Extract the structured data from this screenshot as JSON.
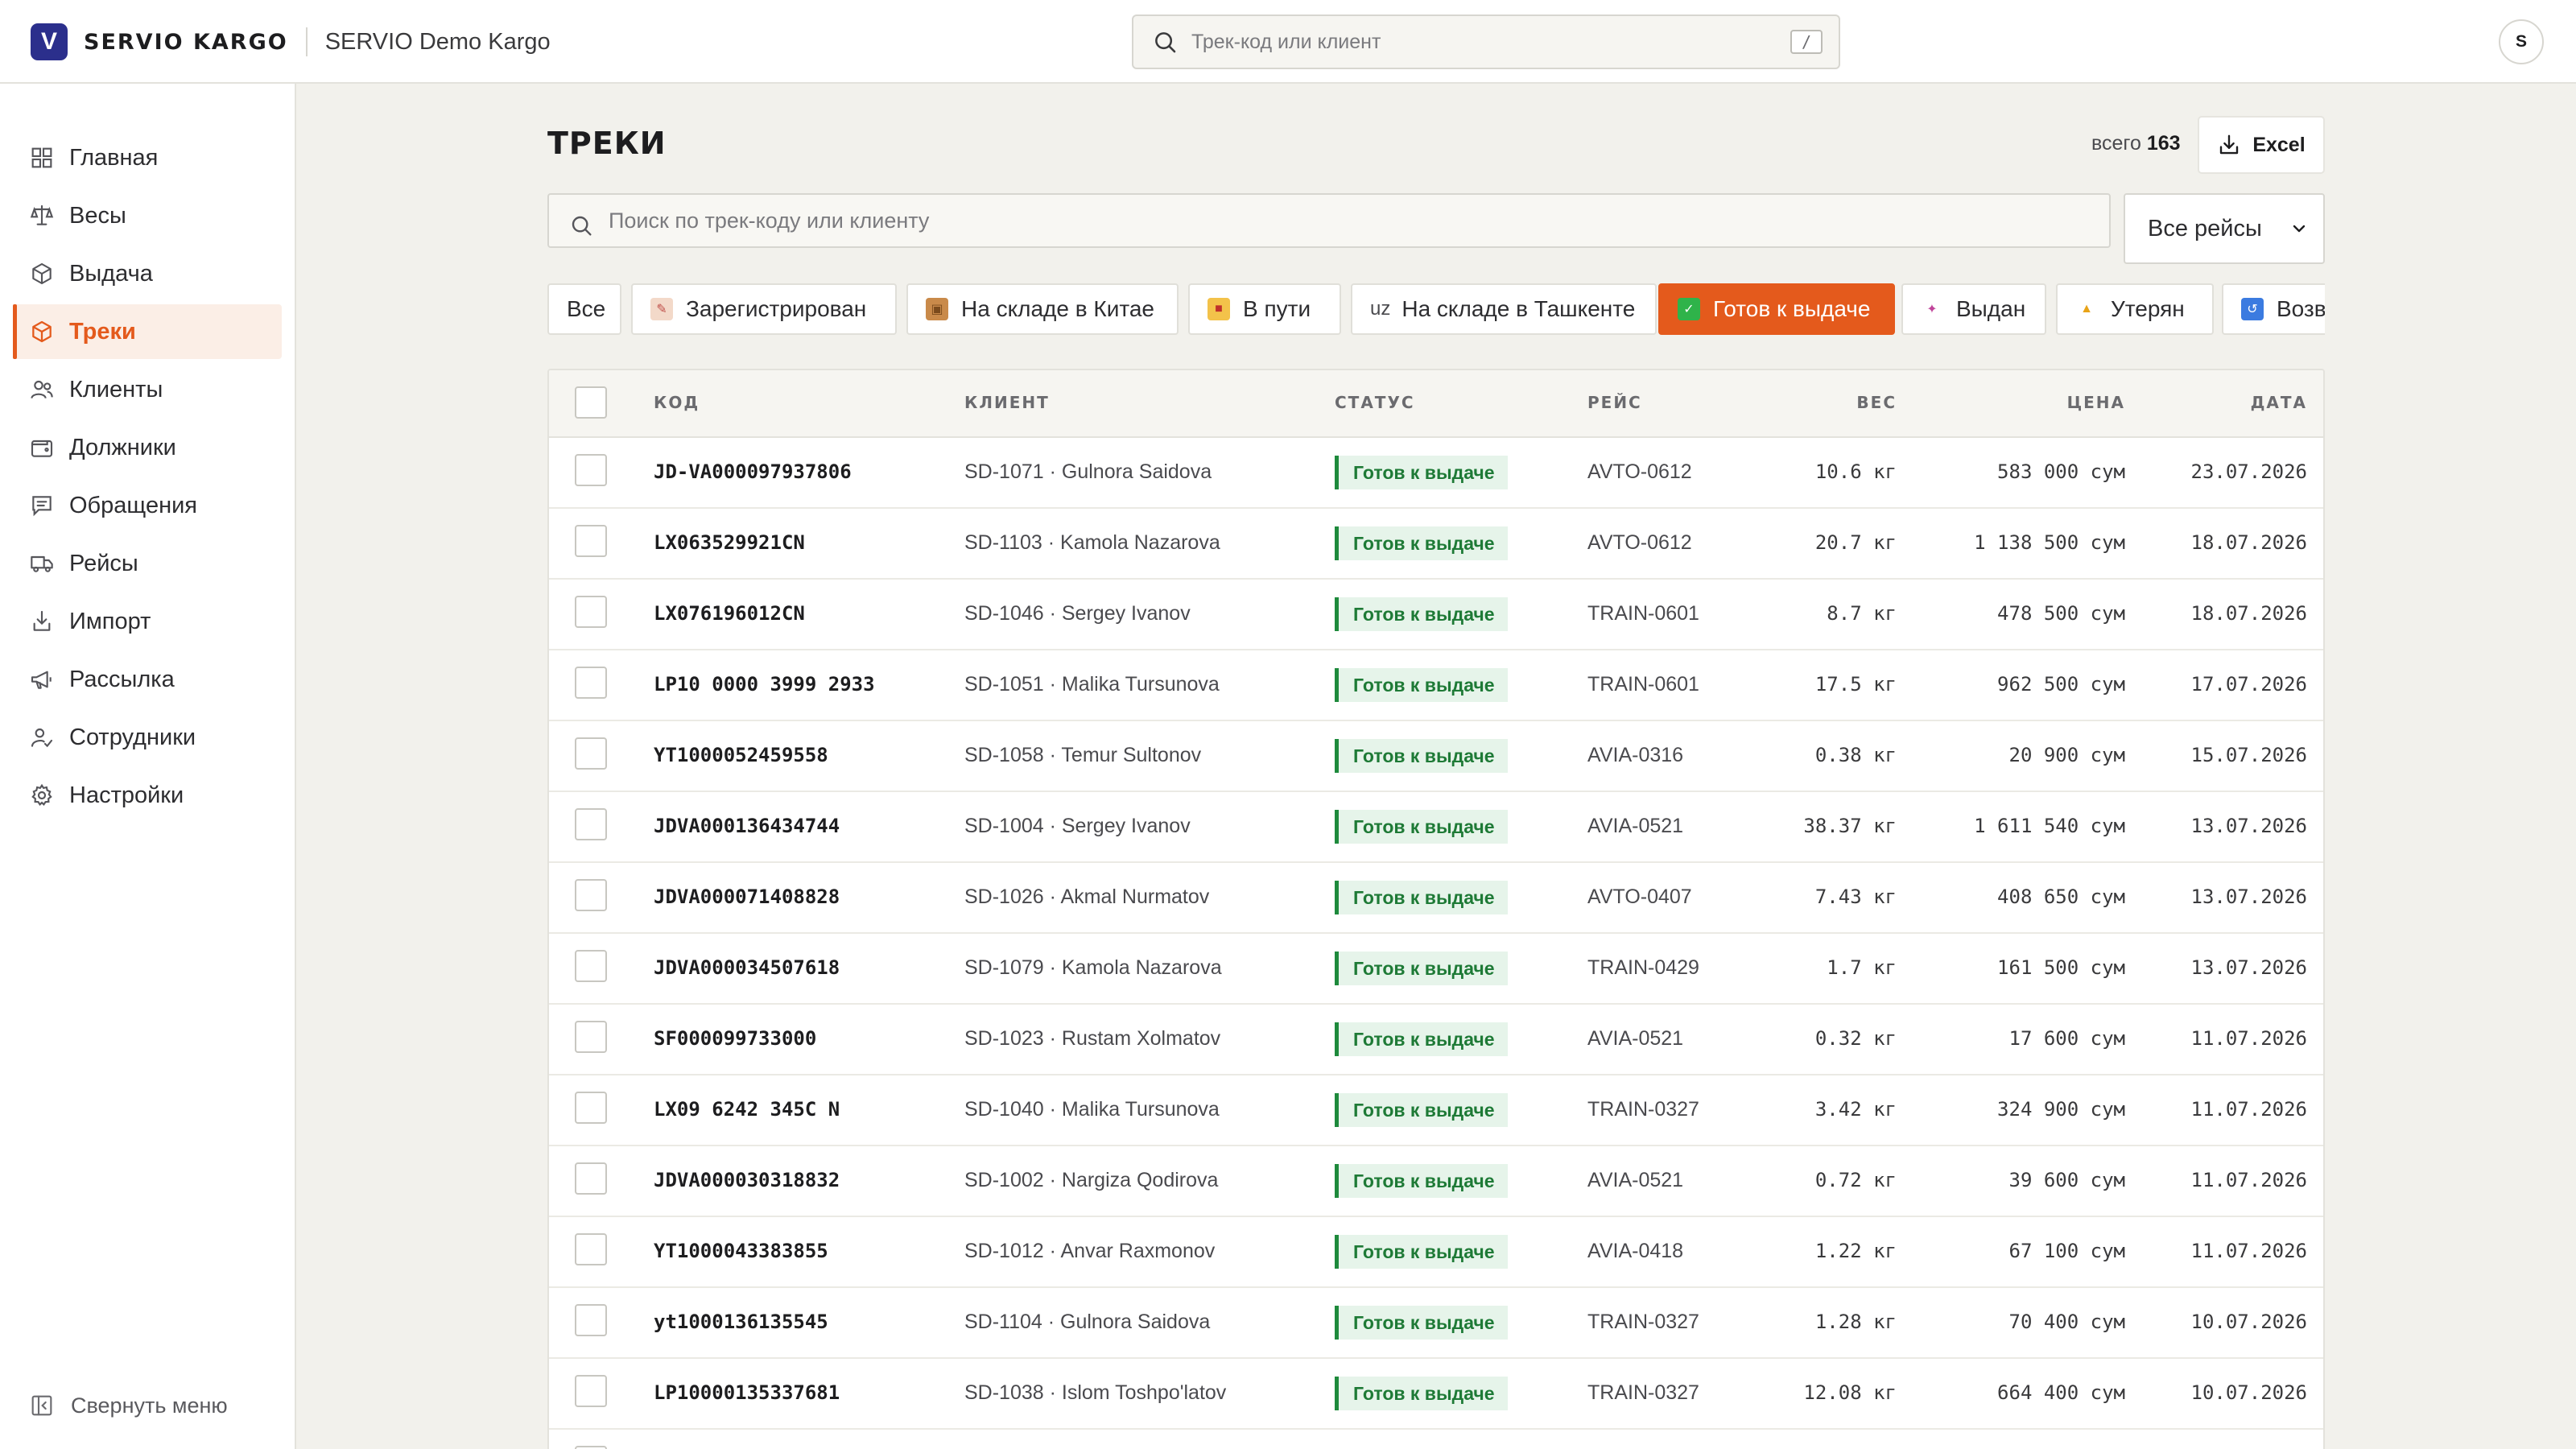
{
  "brand": {
    "logo_letter": "V",
    "name": "SERVIO KARGO",
    "org": "SERVIO Demo Kargo"
  },
  "top_search": {
    "placeholder": "Трек-код или клиент",
    "shortcut": "/"
  },
  "user": {
    "initial": "S"
  },
  "sidebar": {
    "items": [
      {
        "label": "Главная",
        "icon": "grid-icon"
      },
      {
        "label": "Весы",
        "icon": "scale-icon"
      },
      {
        "label": "Выдача",
        "icon": "package-icon"
      },
      {
        "label": "Треки",
        "icon": "box-icon",
        "active": true
      },
      {
        "label": "Клиенты",
        "icon": "users-icon"
      },
      {
        "label": "Должники",
        "icon": "wallet-icon"
      },
      {
        "label": "Обращения",
        "icon": "message-icon"
      },
      {
        "label": "Рейсы",
        "icon": "truck-icon"
      },
      {
        "label": "Импорт",
        "icon": "import-icon"
      },
      {
        "label": "Рассылка",
        "icon": "megaphone-icon"
      },
      {
        "label": "Сотрудники",
        "icon": "staff-icon"
      },
      {
        "label": "Настройки",
        "icon": "gear-icon"
      }
    ],
    "collapse_label": "Свернуть меню"
  },
  "page": {
    "title": "ТРЕКИ",
    "total_prefix": "всего",
    "total_count": "163",
    "excel_label": "Excel",
    "search_placeholder": "Поиск по трек-коду или клиенту",
    "flight_filter": "Все рейсы"
  },
  "chips": [
    {
      "label": "Все",
      "icon": ""
    },
    {
      "label": "Зарегистрирован",
      "icon": "memo-icon"
    },
    {
      "label": "На складе в Китае",
      "icon": "package-icon"
    },
    {
      "label": "В пути",
      "icon": "truck-icon"
    },
    {
      "label": "На складе в Ташкенте",
      "icon": "uz-flag-icon",
      "prefix": "uz"
    },
    {
      "label": "Готов к выдаче",
      "icon": "check-icon",
      "active": true
    },
    {
      "label": "Выдан",
      "icon": "party-icon"
    },
    {
      "label": "Утерян",
      "icon": "warning-icon"
    },
    {
      "label": "Возвр",
      "icon": "return-icon"
    }
  ],
  "table": {
    "columns": {
      "code": "КОД",
      "client": "КЛИЕНТ",
      "status": "СТАТУС",
      "flight": "РЕЙС",
      "weight": "ВЕС",
      "price": "ЦЕНА",
      "date": "ДАТА"
    },
    "rows": [
      {
        "code": "JD-VA000097937806",
        "client": "SD-1071 · Gulnora Saidova",
        "status": "Готов к выдаче",
        "flight": "AVTO-0612",
        "weight": "10.6 кг",
        "price": "583 000 сум",
        "date": "23.07.2026"
      },
      {
        "code": "LX063529921CN",
        "client": "SD-1103 · Kamola Nazarova",
        "status": "Готов к выдаче",
        "flight": "AVTO-0612",
        "weight": "20.7 кг",
        "price": "1 138 500 сум",
        "date": "18.07.2026"
      },
      {
        "code": "LX076196012CN",
        "client": "SD-1046 · Sergey Ivanov",
        "status": "Готов к выдаче",
        "flight": "TRAIN-0601",
        "weight": "8.7 кг",
        "price": "478 500 сум",
        "date": "18.07.2026"
      },
      {
        "code": "LP10 0000 3999 2933",
        "client": "SD-1051 · Malika Tursunova",
        "status": "Готов к выдаче",
        "flight": "TRAIN-0601",
        "weight": "17.5 кг",
        "price": "962 500 сум",
        "date": "17.07.2026"
      },
      {
        "code": "YT1000052459558",
        "client": "SD-1058 · Temur Sultonov",
        "status": "Готов к выдаче",
        "flight": "AVIA-0316",
        "weight": "0.38 кг",
        "price": "20 900 сум",
        "date": "15.07.2026"
      },
      {
        "code": "JDVA000136434744",
        "client": "SD-1004 · Sergey Ivanov",
        "status": "Готов к выдаче",
        "flight": "AVIA-0521",
        "weight": "38.37 кг",
        "price": "1 611 540 сум",
        "date": "13.07.2026"
      },
      {
        "code": "JDVA000071408828",
        "client": "SD-1026 · Akmal Nurmatov",
        "status": "Готов к выдаче",
        "flight": "AVTO-0407",
        "weight": "7.43 кг",
        "price": "408 650 сум",
        "date": "13.07.2026"
      },
      {
        "code": "JDVA000034507618",
        "client": "SD-1079 · Kamola Nazarova",
        "status": "Готов к выдаче",
        "flight": "TRAIN-0429",
        "weight": "1.7 кг",
        "price": "161 500 сум",
        "date": "13.07.2026"
      },
      {
        "code": "SF000099733000",
        "client": "SD-1023 · Rustam Xolmatov",
        "status": "Готов к выдаче",
        "flight": "AVIA-0521",
        "weight": "0.32 кг",
        "price": "17 600 сум",
        "date": "11.07.2026"
      },
      {
        "code": "LX09 6242 345C N",
        "client": "SD-1040 · Malika Tursunova",
        "status": "Готов к выдаче",
        "flight": "TRAIN-0327",
        "weight": "3.42 кг",
        "price": "324 900 сум",
        "date": "11.07.2026"
      },
      {
        "code": "JDVA000030318832",
        "client": "SD-1002 · Nargiza Qodirova",
        "status": "Готов к выдаче",
        "flight": "AVIA-0521",
        "weight": "0.72 кг",
        "price": "39 600 сум",
        "date": "11.07.2026"
      },
      {
        "code": "YT1000043383855",
        "client": "SD-1012 · Anvar Raxmonov",
        "status": "Готов к выдаче",
        "flight": "AVIA-0418",
        "weight": "1.22 кг",
        "price": "67 100 сум",
        "date": "11.07.2026"
      },
      {
        "code": "yt1000136135545",
        "client": "SD-1104 · Gulnora Saidova",
        "status": "Готов к выдаче",
        "flight": "TRAIN-0327",
        "weight": "1.28 кг",
        "price": "70 400 сум",
        "date": "10.07.2026"
      },
      {
        "code": "LP10000135337681",
        "client": "SD-1038 · Islom Toshpo'latov",
        "status": "Готов к выдаче",
        "flight": "TRAIN-0327",
        "weight": "12.08 кг",
        "price": "664 400 сум",
        "date": "10.07.2026"
      }
    ]
  },
  "colors": {
    "accent": "#e45a1c",
    "brand": "#2b2f8c",
    "status_green": "#1e7a36"
  }
}
